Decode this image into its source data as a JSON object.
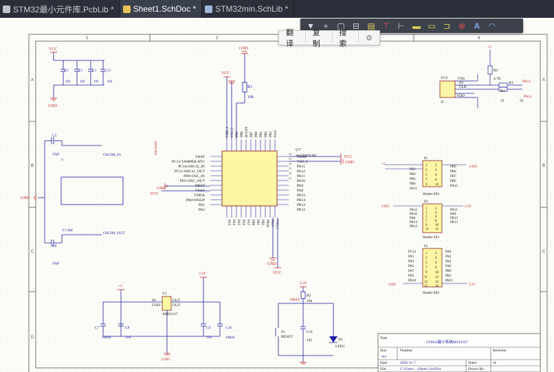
{
  "tabs": [
    {
      "label": "STM32最小元件库.PcbLib *",
      "icon_color": "#c0c4cc"
    },
    {
      "label": "Sheet1.SchDoc *",
      "icon_color": "#e7c35a"
    },
    {
      "label": "STM32min.SchLib *",
      "icon_color": "#9fb6d8"
    }
  ],
  "context_menu": {
    "translate": "翻译",
    "copy": "复制",
    "search": "搜索"
  },
  "toolbar_icons": [
    "filter-icon",
    "plus-icon",
    "select-rect-icon",
    "align-icon",
    "bus-icon",
    "wire-icon",
    "power-port-icon",
    "net-label-icon",
    "port-icon",
    "harness-icon",
    "no-erc-icon",
    "text-icon",
    "arc-icon"
  ],
  "sheet": {
    "columns": [
      "1",
      "2",
      "3",
      "4"
    ],
    "rows": [
      "A",
      "B",
      "C",
      "D"
    ],
    "title_block": {
      "title_label": "Title",
      "title_value": "STM32最小系统MSYI107",
      "size_label": "Size",
      "size_value": "A4",
      "number_label": "Number",
      "revision_label": "Revision",
      "date_label": "Date",
      "date_value": "2020-11-7",
      "sheet_label": "Sheet",
      "sheet_of": "of",
      "file_label": "File",
      "file_value": "C:\\Users\\...\\Sheet1.SchDoc",
      "drawn_label": "Drawn By:"
    }
  },
  "schematic": {
    "vcc": "VCC",
    "gnd": "GND",
    "v5": "+5",
    "v33": "3.3V",
    "caps_top": [
      "C1",
      "C2",
      "C3",
      "C4"
    ],
    "caps_top_values": [
      "104",
      "104",
      "104",
      "104"
    ],
    "crystal": {
      "c5": "C5",
      "c5_val": "22pf",
      "c6": "C6",
      "c6_val": "22pf",
      "y": "Y1 8M",
      "osc_in": "OSCIM_IN",
      "osc_out": "OSCIM_OUT",
      "pin3": "3"
    },
    "r1": {
      "ref": "R1",
      "val": "10k"
    },
    "mcu": {
      "ref": "U7",
      "name": "stm32f103c8t6",
      "left_pins": [
        "VBAT",
        "PC13-TAMPER-RTC",
        "PC14-OSC32_IN",
        "PC15-OSC32_OUT",
        "PD0-OSC_IN",
        "PD1-OSC_OUT",
        "NRST",
        "VSSA",
        "VDDA",
        "PA0-WKUP",
        "PA1",
        "PA2"
      ],
      "right_pins": [
        "VBAT",
        "VSS_3",
        "PA15",
        "PA12",
        "PA11",
        "PA10",
        "PA9",
        "PA8",
        "PB15",
        "PB14",
        "PB13",
        "PB12"
      ],
      "right_nums": [
        "36",
        "35",
        "34",
        "33",
        "32",
        "31",
        "30",
        "29",
        "28",
        "27",
        "26",
        "25"
      ],
      "top_pins": [
        "VDD_3",
        "VSS_3",
        "PB9",
        "PB8",
        "BOOT0",
        "PB7",
        "PB6",
        "PB5",
        "PB4",
        "PB3",
        "PA15"
      ],
      "bottom_pins": [
        "PA3",
        "PA4",
        "PA5",
        "PA6",
        "PA7",
        "PB0",
        "PB1",
        "PB2",
        "PB10",
        "PB11",
        "VSS_1",
        "VDD_1"
      ],
      "net_vcc_right": "VCC",
      "net_gnd_right": "GND",
      "vcc_left": "VCC",
      "gnd_left": "GND",
      "net_label_vbat": "NuLabel8"
    },
    "swd": {
      "ref": "J1",
      "pins": [
        "VSS",
        "IO",
        "CLK",
        "VDD"
      ],
      "r2": "R2",
      "r2_val": "4.7K",
      "r3": "R3",
      "r4": "R4",
      "r_val": "22",
      "net1": "PA12",
      "net2": "PA11",
      "v": "+5"
    },
    "header_p1": {
      "ref": "P1",
      "label": "Header 8X2",
      "left": [
        "PB3",
        "PB4",
        "PB5",
        "PB6",
        "PA15"
      ],
      "right": [
        "PB9",
        "PB8",
        "PB7",
        "PB6",
        "PA14"
      ],
      "nums": [
        [
          "1",
          "2"
        ],
        [
          "3",
          "4"
        ],
        [
          "5",
          "6"
        ],
        [
          "7",
          "8"
        ],
        [
          "9",
          "10"
        ]
      ]
    },
    "header_p2": {
      "ref": "P2",
      "label": "Header 6X2",
      "left": [
        "PA12",
        "PA10",
        "PA8",
        "PB14",
        "PB12"
      ],
      "right": [
        "PA11",
        "PA9",
        "PB15",
        "PB13"
      ],
      "nums": [
        [
          "1",
          "2"
        ],
        [
          "3",
          "4"
        ],
        [
          "5",
          "6"
        ],
        [
          "7",
          "8"
        ],
        [
          "9",
          "10"
        ],
        [
          "11",
          "12"
        ]
      ]
    },
    "header_p3": {
      "ref": "P3",
      "label": "Header 8X2",
      "left": [
        "PC13",
        "PA1",
        "PA3",
        "PA5",
        "PA7",
        "PB1",
        "PB10"
      ],
      "right": [
        "PA0",
        "PA2",
        "PA4",
        "PA6",
        "PB0",
        "PB2",
        "PB11"
      ],
      "nums": [
        [
          "1",
          "2"
        ],
        [
          "3",
          "4"
        ],
        [
          "5",
          "6"
        ],
        [
          "7",
          "8"
        ],
        [
          "9",
          "10"
        ],
        [
          "11",
          "12"
        ],
        [
          "13",
          "14"
        ],
        [
          "15",
          "16"
        ]
      ]
    },
    "power": {
      "u1": "U1",
      "ams": "AMS1117",
      "in": "IN",
      "gnd": "GND",
      "out": "OUT",
      "out2": "OUT",
      "c7": "C7",
      "c8": "C8",
      "c8_val": "104",
      "c7_val": "100uF",
      "c9": "C9",
      "c9_val": "104",
      "c10": "C10",
      "c10_val": "100uF",
      "pin3": "3",
      "pin1": "1",
      "pin2": "2",
      "pin4": "4"
    },
    "reset": {
      "r": "R5",
      "r_val": "10k",
      "nrst": "NRST",
      "s": "S1",
      "s_label": "RESET",
      "c": "C11",
      "c_val": "105",
      "d": "D1",
      "d_label": "LED1"
    }
  }
}
